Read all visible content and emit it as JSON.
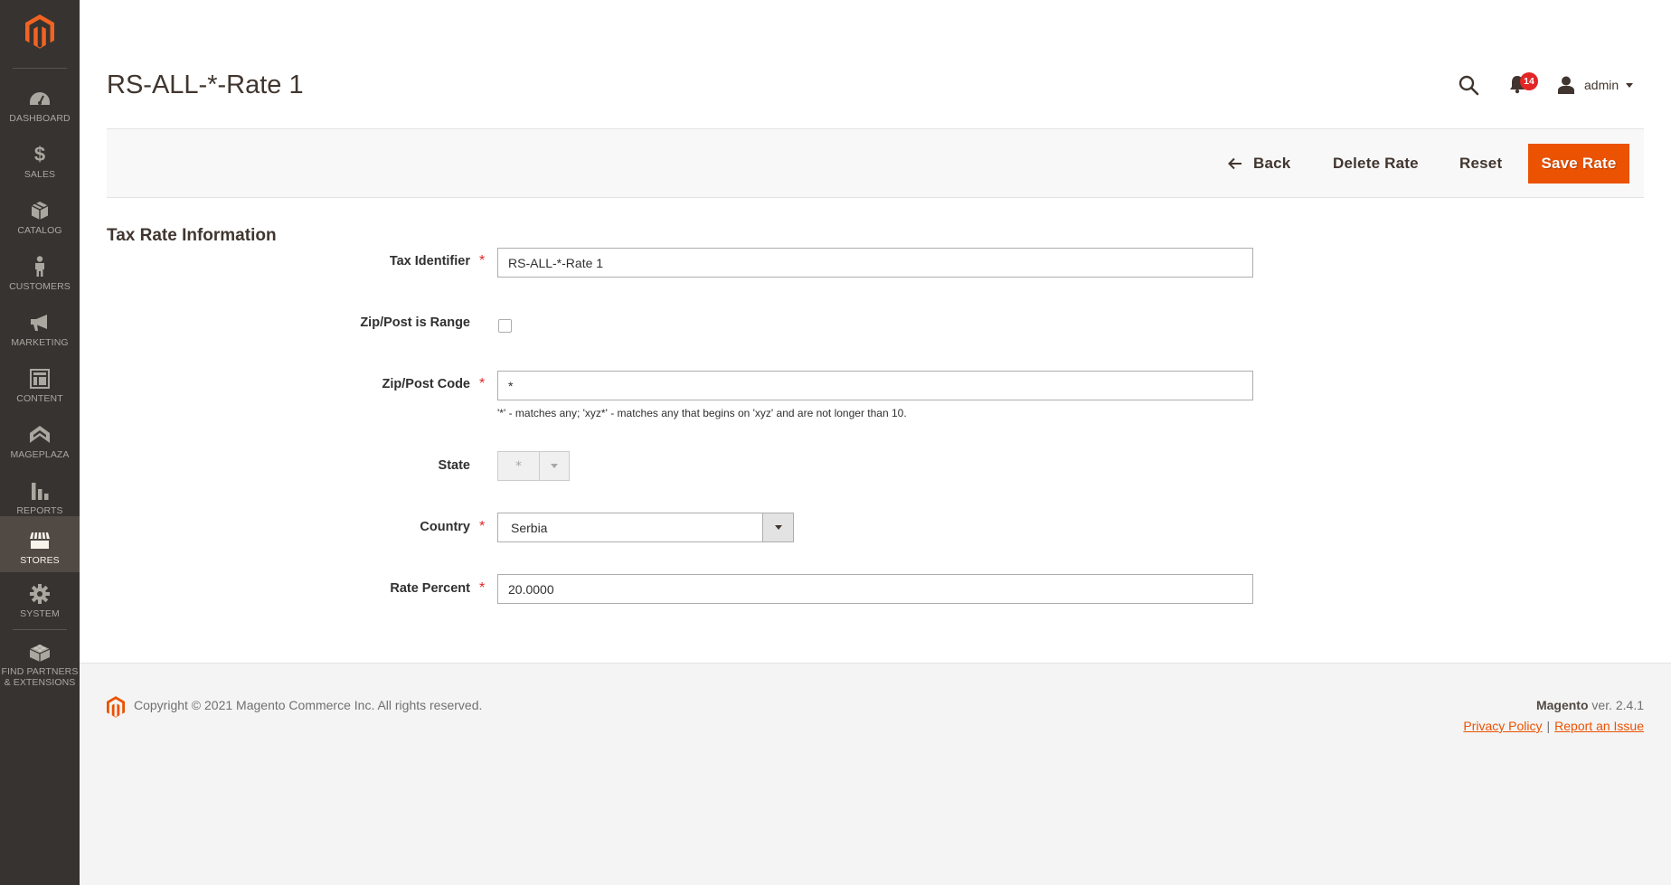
{
  "sidebar": {
    "logo": "magento-logo",
    "items": [
      {
        "key": "dashboard",
        "label": "DASHBOARD",
        "icon": "dashboard-gauge-icon",
        "active": false
      },
      {
        "key": "sales",
        "label": "SALES",
        "icon": "dollar-icon",
        "active": false
      },
      {
        "key": "catalog",
        "label": "CATALOG",
        "icon": "box-icon",
        "active": false
      },
      {
        "key": "customers",
        "label": "CUSTOMERS",
        "icon": "person-icon",
        "active": false
      },
      {
        "key": "marketing",
        "label": "MARKETING",
        "icon": "megaphone-icon",
        "active": false
      },
      {
        "key": "content",
        "label": "CONTENT",
        "icon": "layout-icon",
        "active": false
      },
      {
        "key": "mageplaza",
        "label": "MAGEPLAZA",
        "icon": "mageplaza-icon",
        "active": false
      },
      {
        "key": "reports",
        "label": "REPORTS",
        "icon": "bar-chart-icon",
        "active": false
      },
      {
        "key": "stores",
        "label": "STORES",
        "icon": "storefront-icon",
        "active": true
      },
      {
        "key": "system",
        "label": "SYSTEM",
        "icon": "gear-icon",
        "active": false
      },
      {
        "key": "partners",
        "label": "FIND PARTNERS\n& EXTENSIONS",
        "label_line1": "FIND PARTNERS",
        "label_line2": "& EXTENSIONS",
        "icon": "lego-brick-icon",
        "active": false
      }
    ]
  },
  "header": {
    "title": "RS-ALL-*-Rate 1",
    "notifications_count": "14",
    "user_name": "admin"
  },
  "page_actions": {
    "back_label": "Back",
    "delete_label": "Delete Rate",
    "reset_label": "Reset",
    "save_label": "Save Rate"
  },
  "form": {
    "section_title": "Tax Rate Information",
    "tax_identifier": {
      "label": "Tax Identifier",
      "value": "RS-ALL-*-Rate 1",
      "required": true
    },
    "zip_is_range": {
      "label": "Zip/Post is Range",
      "checked": false
    },
    "zip_code": {
      "label": "Zip/Post Code",
      "value": "*",
      "required": true,
      "note": "'*' - matches any; 'xyz*' - matches any that begins on 'xyz' and are not longer than 10."
    },
    "state": {
      "label": "State",
      "value": "*",
      "disabled": true
    },
    "country": {
      "label": "Country",
      "value": "Serbia",
      "required": true
    },
    "rate_percent": {
      "label": "Rate Percent",
      "value": "20.0000",
      "required": true
    }
  },
  "footer": {
    "copyright": "Copyright © 2021 Magento Commerce Inc. All rights reserved.",
    "brand": "Magento",
    "version": "ver. 2.4.1",
    "privacy_label": "Privacy Policy",
    "separator": "|",
    "report_label": "Report an Issue"
  },
  "colors": {
    "accent": "#eb5202",
    "sidebar_bg": "#373330",
    "sidebar_active": "#514943",
    "badge": "#e22626",
    "required": "#e22626"
  }
}
